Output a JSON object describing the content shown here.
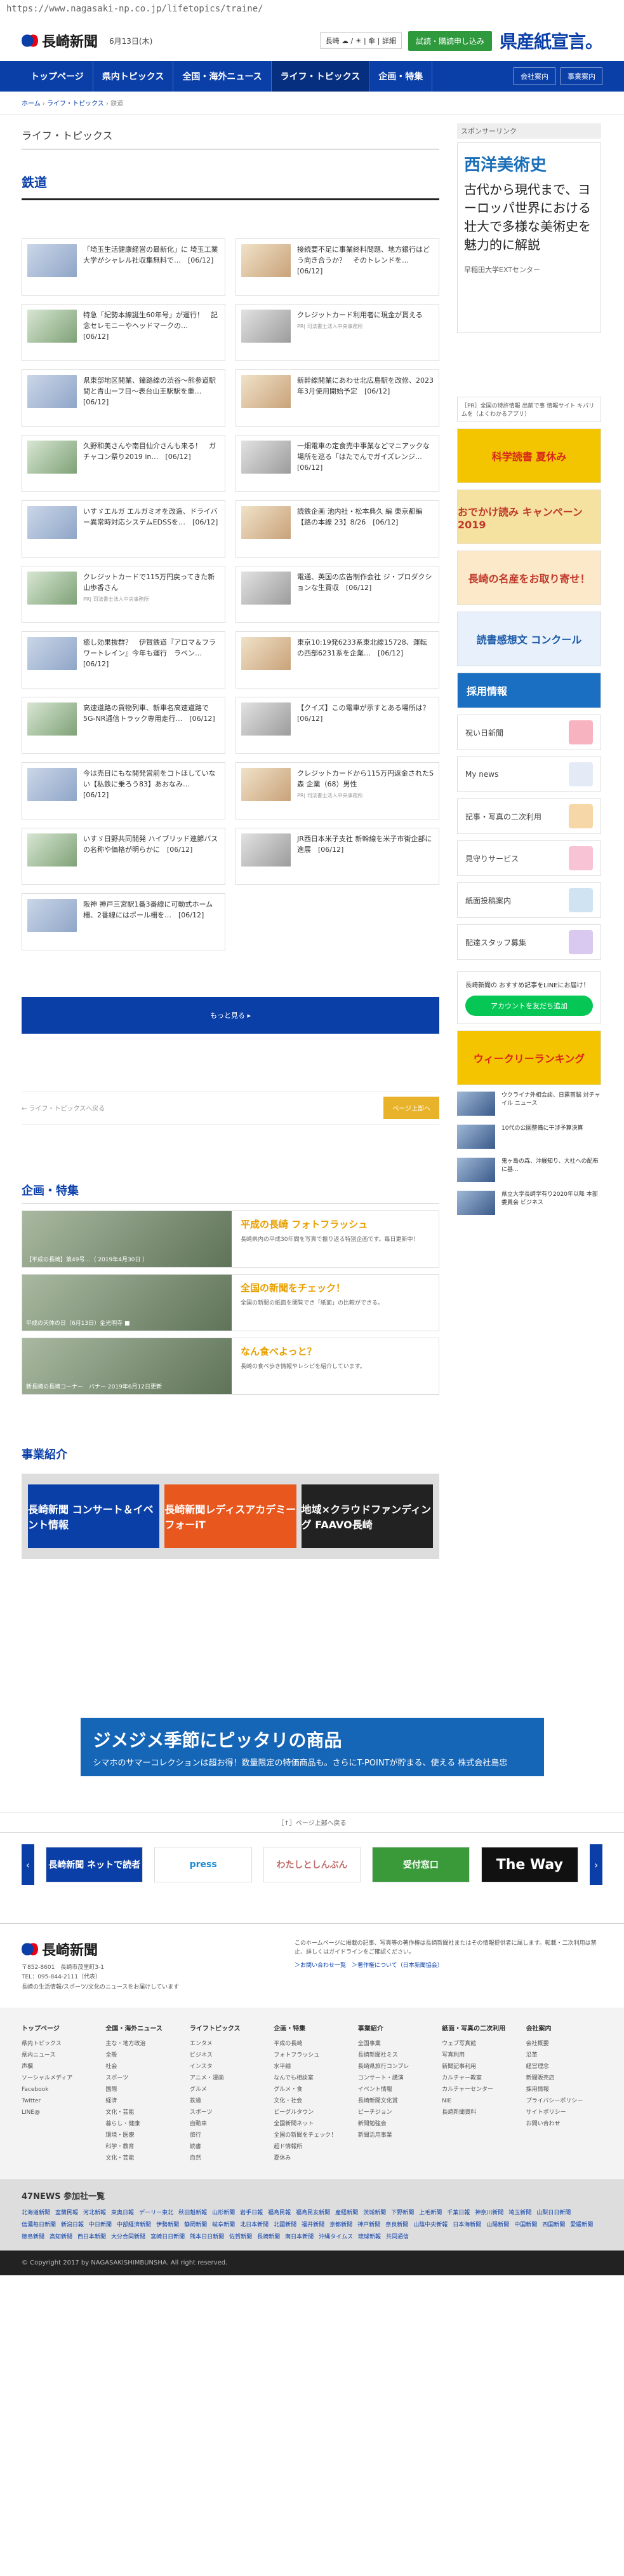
{
  "url": "https://www.nagasaki-np.co.jp/lifetopics/traine/",
  "header": {
    "logo": "長崎新聞",
    "date": "6月13日(木)",
    "weather": "長崎 ☁ / ☀ | 傘 | 詳細",
    "trial": "試読・購読申し込み",
    "banner": "県産紙宣言。"
  },
  "nav": {
    "items": [
      "トップページ",
      "県内トピックス",
      "全国・海外ニュース",
      "ライフ・トピックス",
      "企画・特集"
    ],
    "active": 3,
    "login": "会社案内",
    "register": "事業案内"
  },
  "breadcrumb": [
    "ホーム",
    "ライフ・トピックス",
    "鉄道"
  ],
  "section": {
    "title": "ライフ・トピックス",
    "topic": "鉄道"
  },
  "articles": [
    {
      "title": "「埼玉生活健康経営の最新化」に 埼玉工業大学がシャレル社収集無料で…　[06/12]",
      "pr": ""
    },
    {
      "title": "接続要不足に事業終料問題、地方銀行はどう向き合うか？　そのトレンドを…　[06/12]",
      "pr": ""
    },
    {
      "title": "特急「紀勢本線誕生60年号」が運行！　記念セレモニーやヘッドマークの…　[06/12]",
      "pr": ""
    },
    {
      "title": "クレジットカード利用者に現金が貰える",
      "pr": "PR| 司法書士法人中央事務所"
    },
    {
      "title": "県東部地区開業、鐘路線の渋谷～熊参道駅間と青山ーフ目～表台山王駅駅を重…　[06/12]",
      "pr": ""
    },
    {
      "title": "新幹線開業にあわせ北広島駅を改修、2023年3月使用開始予定　[06/12]",
      "pr": ""
    },
    {
      "title": "久野和美さんや南目仙介さんも来る！　ガチャコン祭り2019 in…　[06/12]",
      "pr": ""
    },
    {
      "title": "一畑電車の定食売中事業などマニアックな場所を巡る「はたでんでガイズレンジ…　[06/12]",
      "pr": ""
    },
    {
      "title": "いすゞエルガ エルガミオを改造、ドライバー異常時対応システムEDSSを…　[06/12]",
      "pr": ""
    },
    {
      "title": "読鉄企画 池内社・松本典久 編 東京都編【路の本線 23】8/26　[06/12]",
      "pr": ""
    },
    {
      "title": "クレジットカードで115万円戻ってきた新山歩香さん",
      "pr": "PR| 司法書士法人中央事務所"
    },
    {
      "title": "電通、英国の広告制作会社 ジ・プロダクションな生買収　[06/12]",
      "pr": ""
    },
    {
      "title": "癒し効果抜群？　伊賀鉄道『アロマ＆フラワートレイン』今年も運行　ラベン…　[06/12]",
      "pr": ""
    },
    {
      "title": "東京10:19発6233系東北線15728、運転の西部6231系を企業…　[06/12]",
      "pr": ""
    },
    {
      "title": "高速道路の貨物列車、新車名高速道路で5G-NR通信トラック専用走行…　[06/12]",
      "pr": ""
    },
    {
      "title": "【クイズ】この電車が示すとある場所は？　[06/12]",
      "pr": ""
    },
    {
      "title": "今は売日にもな開発営前をコトほしていない【私鉄に乗ろう83】あおなみ…　[06/12]",
      "pr": ""
    },
    {
      "title": "クレジットカードから115万円返金されたS森 企業（68）男性",
      "pr": "PR| 司法書士法人中央事務所"
    },
    {
      "title": "いすゞ日野共同開発 ハイブリッド連節バスの名称や価格が明らかに　[06/12]",
      "pr": ""
    },
    {
      "title": "JR西日本米子支社 新幹線を米子市街企部に進展　[06/12]",
      "pr": ""
    },
    {
      "title": "阪神 神戸三宮駅1番3番線に可動式ホーム柵、2番線にはポール柵を…　[06/12]",
      "pr": ""
    }
  ],
  "more_button": "もっと見る ▸",
  "pager": {
    "prev": "← ライフ・トピックスへ戻る",
    "next": "ページ上部へ"
  },
  "features": {
    "heading": "企画・特集",
    "items": [
      {
        "title": "平成の長崎 フォトフラッシュ",
        "desc": "長崎県内の平成30年間を写真で振り返る特別企画です。毎日更新中！",
        "caption": "【平成の長崎】第49号…（ 2019年4月30日 ）"
      },
      {
        "title": "全国の新聞をチェック！",
        "desc": "全国の新聞の紙面を閲覧でき「紙面」の比較ができる。",
        "caption": "平成の天体の日（6月13日）金光明寺 ■"
      },
      {
        "title": "なん食べよっと？",
        "desc": "長崎の食べ歩き情報やレシピを紹介しています。",
        "caption": "新長崎の長崎コーナー　バナー 2019年6月12日更新"
      }
    ]
  },
  "business": {
    "heading": "事業紹介",
    "slides": [
      "長崎新聞 コンサート＆イベント情報",
      "長崎新聞レディスアカデミー フォーiT",
      "地域×クラウドファンディング FAAVO長崎"
    ]
  },
  "sidebar": {
    "sponsor_label": "スポンサーリンク",
    "ad": {
      "head": "西洋美術史",
      "body": "古代から現代まで、ヨーロッパ世界における壮大で多様な美術史を魅力的に解説",
      "foot": "早稲田大学EXTセンター"
    },
    "small_ad": "［PR］全国の特許情報 出前で事 情報サイト キバリムを（よくわかるアプリ）",
    "promos": [
      "科学読書 夏休み",
      "おでかけ読み キャンペーン 2019",
      "長崎の名産をお取り寄せ！",
      "読書感想文 コンクール"
    ],
    "services": [
      "採用情報",
      "祝い日新聞",
      "My news",
      "記事・写真の二次利用",
      "見守りサービス",
      "紙面投稿案内",
      "配達スタッフ募集"
    ],
    "line": {
      "title": "長崎新聞の おすすめ記事をLINEにお届け！",
      "button": "アカウントを友だち追加"
    },
    "weekly": "ウィークリーランキング",
    "list": [
      "ウクライナ外相会談、日露首脳 対チャイル ニュース",
      "10代の公園整備に干渉予算決算",
      "鬼ヶ島の森、沖展知り、大社への配布に基…",
      "県立大学長崎学有り2020年以降 本部委員会 ビジネス"
    ]
  },
  "bottom_ad": {
    "head": "ジメジメ季節にピッタリの商品",
    "body": "シマホのサマーコレクションは超お得！数量限定の特価商品も。さらにT-POINTが貯まる、使える 株式会社島忠"
  },
  "page_top": "［↑］ページ上部へ戻る",
  "carousel": [
    "長崎新聞 ネットで読者",
    "press",
    "わたしとしんぶん",
    "受付窓口",
    "The Way"
  ],
  "footer": {
    "logo": "長崎新聞",
    "address": "〒852-8601　長崎市茂里町3-1",
    "tel": "TEL：095-844-2111（代表）",
    "tagline": "長崎の生活情報/スポーツ/文化のニュースをお届けしています",
    "note": "このホームページに掲載の記事、写真等の著作権は長崎新聞社またはその情報提供者に属します。転載・二次利用は禁止、詳しくはガイドラインをご確認ください。",
    "links": [
      "＞お問い合わせ一覧",
      "＞著作権について（日本新聞協会）"
    ]
  },
  "sitemap": [
    {
      "head": "トップページ",
      "items": [
        "県内トピックス",
        "県内ニュース",
        "声欄",
        "ソーシャルメディア",
        "Facebook",
        "Twitter",
        "LINE@"
      ]
    },
    {
      "head": "全国・海外ニュース",
      "items": [
        "主な・地方政治",
        "全般",
        "社会",
        "スポーツ",
        "国際",
        "経済",
        "文化・芸能",
        "暮らし・健康",
        "環境・医療",
        "科学・教育",
        "文化・芸能"
      ]
    },
    {
      "head": "ライフトピックス",
      "items": [
        "エンタメ",
        "ビジネス",
        "インスタ",
        "アニメ・漫画",
        "グルメ",
        "鉄道",
        "スポーツ",
        "自動車",
        "旅行",
        "読書",
        "自然"
      ]
    },
    {
      "head": "企画・特集",
      "items": [
        "平成の長崎",
        "フォトフラッシュ",
        "水平線",
        "なんでも相談室",
        "グルメ・食",
        "文化・社会",
        "ビーグルタウン",
        "全国新聞ネット",
        "全国の新聞をチェック！",
        "超ド情報所",
        "夏休み"
      ]
    },
    {
      "head": "事業紹介",
      "items": [
        "全国事業",
        "長崎新聞社ミス",
        "長崎県旅行コンブレ",
        "コンサート・講演",
        "イベント情報",
        "長崎新聞文化賞",
        "ピーチジョン",
        "新聞勉強会",
        "新聞活用事業"
      ]
    },
    {
      "head": "紙面・写真の二次利用",
      "items": [
        "ウェブ写真館",
        "写真利用",
        "新聞記事利用",
        "カルチャー教室",
        "カルチャーセンター",
        "NIE",
        "長崎新聞資料"
      ]
    },
    {
      "head": "会社案内",
      "items": [
        "会社概要",
        "沿革",
        "経営理念",
        "新聞販売店",
        "採用情報",
        "プライバシーポリシー",
        "サイトポリシー",
        "お問い合わせ"
      ]
    }
  ],
  "n47": {
    "heading": "47NEWS 参加社一覧",
    "members": [
      "北海道新聞",
      "室蘭民報",
      "河北新報",
      "東奥日報",
      "デーリー東北",
      "秋田魁新報",
      "山形新聞",
      "岩手日報",
      "福島民報",
      "福島民友新聞",
      "産経新聞",
      "茨城新聞",
      "下野新聞",
      "上毛新聞",
      "千葉日報",
      "神奈川新聞",
      "埼玉新聞",
      "山梨日日新聞",
      "信濃毎日新聞",
      "新潟日報",
      "中日新聞",
      "中部経済新聞",
      "伊勢新聞",
      "静岡新聞",
      "岐阜新聞",
      "北日本新聞",
      "北國新聞",
      "福井新聞",
      "京都新聞",
      "神戸新聞",
      "奈良新聞",
      "山陰中央新報",
      "日本海新聞",
      "山陽新聞",
      "中国新聞",
      "四国新聞",
      "愛媛新聞",
      "徳島新聞",
      "高知新聞",
      "西日本新聞",
      "大分合同新聞",
      "宮崎日日新聞",
      "熊本日日新聞",
      "佐賀新聞",
      "長崎新聞",
      "南日本新聞",
      "沖縄タイムス",
      "琉球新報",
      "共同通信"
    ]
  },
  "copyright": "© Copyright 2017 by NAGASAKISHIMBUNSHA. All right reserved."
}
